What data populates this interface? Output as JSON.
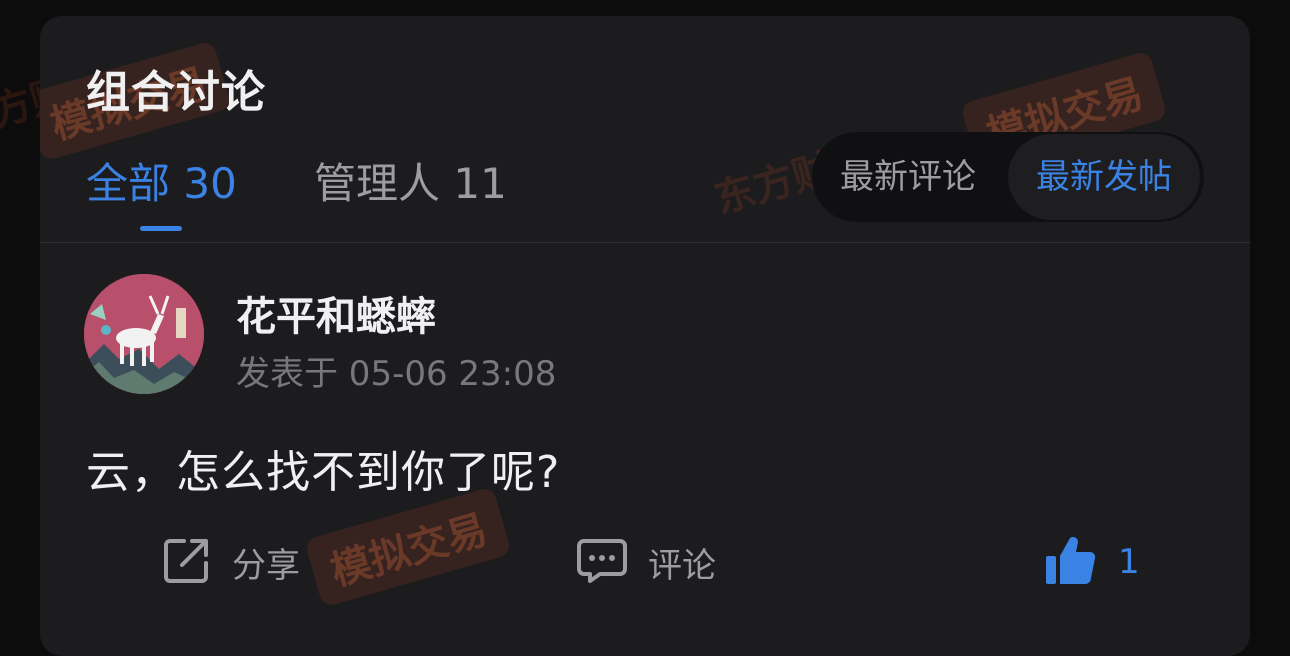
{
  "section_title": "组合讨论",
  "tabs": [
    {
      "label": "全部 30",
      "active": true
    },
    {
      "label": "管理人 11",
      "active": false
    }
  ],
  "sort": {
    "options": [
      "最新评论",
      "最新发帖"
    ],
    "selected": "最新发帖"
  },
  "post": {
    "username": "花平和蟋蟀",
    "time": "发表于 05-06 23:08",
    "content": "云，怎么找不到你了呢?",
    "actions": {
      "share_label": "分享",
      "comment_label": "评论",
      "like_count": "1"
    }
  },
  "watermark": {
    "brand": "东方财富",
    "tag": "模拟交易"
  },
  "colors": {
    "accent": "#3a82e4",
    "background": "#0c0c0d",
    "card": "#1c1c1e"
  }
}
